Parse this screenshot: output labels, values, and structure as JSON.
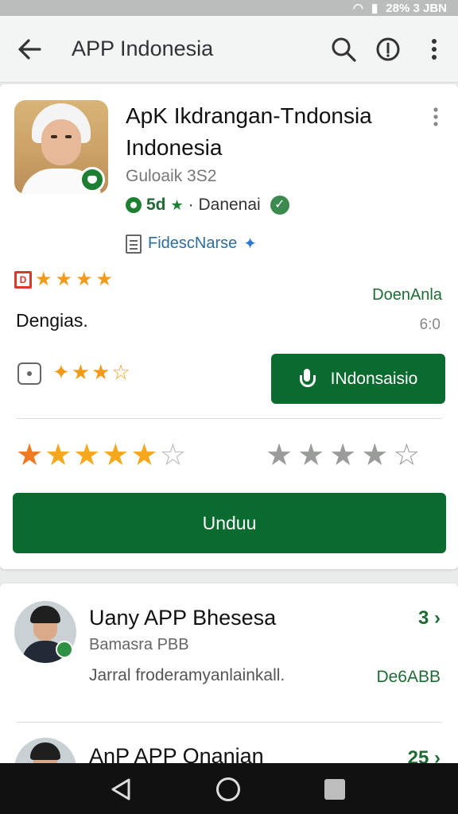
{
  "status_bar": {
    "text": "28% 3 JBN",
    "wifi": "wifi-icon",
    "signal": "signal-icon",
    "battery": "battery-icon"
  },
  "app_bar": {
    "title": "APP Indonesia"
  },
  "app": {
    "name": "ApK Ikdrangan-Tndonsia Indonesia",
    "developer": "Guloaik 3S2",
    "rating": "5d",
    "rating_suffix": "· Danenai",
    "tag": "FidescNarse",
    "small_badge": "D",
    "right_label": "DoenAnla",
    "description": "Dengias.",
    "count": "6:0",
    "language_button": "INdonsaisio",
    "download_button": "Unduu"
  },
  "list": [
    {
      "title": "Uany APP Bhesesa",
      "subtitle": "Bamasra PBB",
      "description": "Jarral froderamyanlainkall.",
      "count": "3",
      "right": "De6ABB"
    },
    {
      "title": "AnP APP Onanian",
      "subtitle": "",
      "description": "",
      "count": "25",
      "right": ""
    }
  ],
  "colors": {
    "primary_green": "#0a6b2f",
    "star_orange": "#f5a81e",
    "star_gray": "#9a9c9a",
    "link_blue": "#2c6e9e"
  }
}
